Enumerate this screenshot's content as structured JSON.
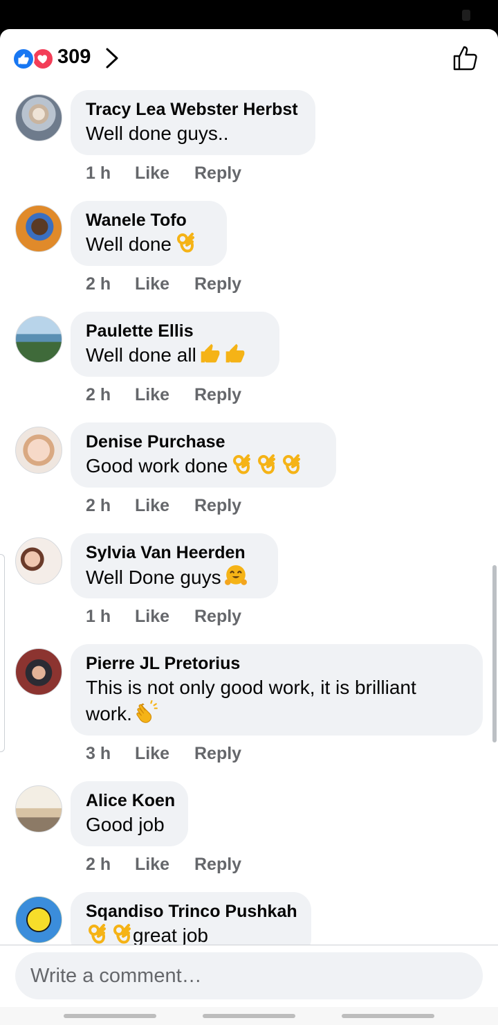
{
  "reactions": {
    "count": "309",
    "types": [
      "like-icon",
      "love-icon"
    ]
  },
  "comments": [
    {
      "author": "Tracy Lea Webster Herbst",
      "text": "Well done guys..",
      "emojis": [],
      "time": "1 h",
      "like": "Like",
      "reply": "Reply"
    },
    {
      "author": "Wanele Tofo",
      "text": "Well done",
      "emojis": [
        "ok-hand-emoji"
      ],
      "time": "2 h",
      "like": "Like",
      "reply": "Reply"
    },
    {
      "author": "Paulette Ellis",
      "text": "Well done all",
      "emojis": [
        "thumbs-up-emoji",
        "thumbs-up-emoji"
      ],
      "time": "2 h",
      "like": "Like",
      "reply": "Reply"
    },
    {
      "author": "Denise Purchase",
      "text": "Good work done",
      "emojis": [
        "ok-hand-emoji",
        "ok-hand-emoji",
        "ok-hand-emoji"
      ],
      "time": "2 h",
      "like": "Like",
      "reply": "Reply"
    },
    {
      "author": "Sylvia Van Heerden",
      "text": "Well Done guys",
      "emojis": [
        "hugging-face-emoji"
      ],
      "time": "1 h",
      "like": "Like",
      "reply": "Reply"
    },
    {
      "author": "Pierre JL Pretorius",
      "text_line1": "This is not only good work, it is brilliant",
      "text_line2": "work.",
      "emojis": [
        "clapping-hands-emoji"
      ],
      "time": "3 h",
      "like": "Like",
      "reply": "Reply"
    },
    {
      "author": "Alice Koen",
      "text": "Good job",
      "emojis": [],
      "time": "2 h",
      "like": "Like",
      "reply": "Reply"
    },
    {
      "author": "Sqandiso Trinco Pushkah",
      "text": "great job",
      "emojis": [
        "ok-hand-emoji",
        "ok-hand-emoji"
      ]
    }
  ],
  "composer": {
    "placeholder": "Write a comment…"
  },
  "colors": {
    "accent": "#1877f2",
    "love": "#f33e58",
    "bubble": "#f0f2f5",
    "meta": "#65676b"
  }
}
